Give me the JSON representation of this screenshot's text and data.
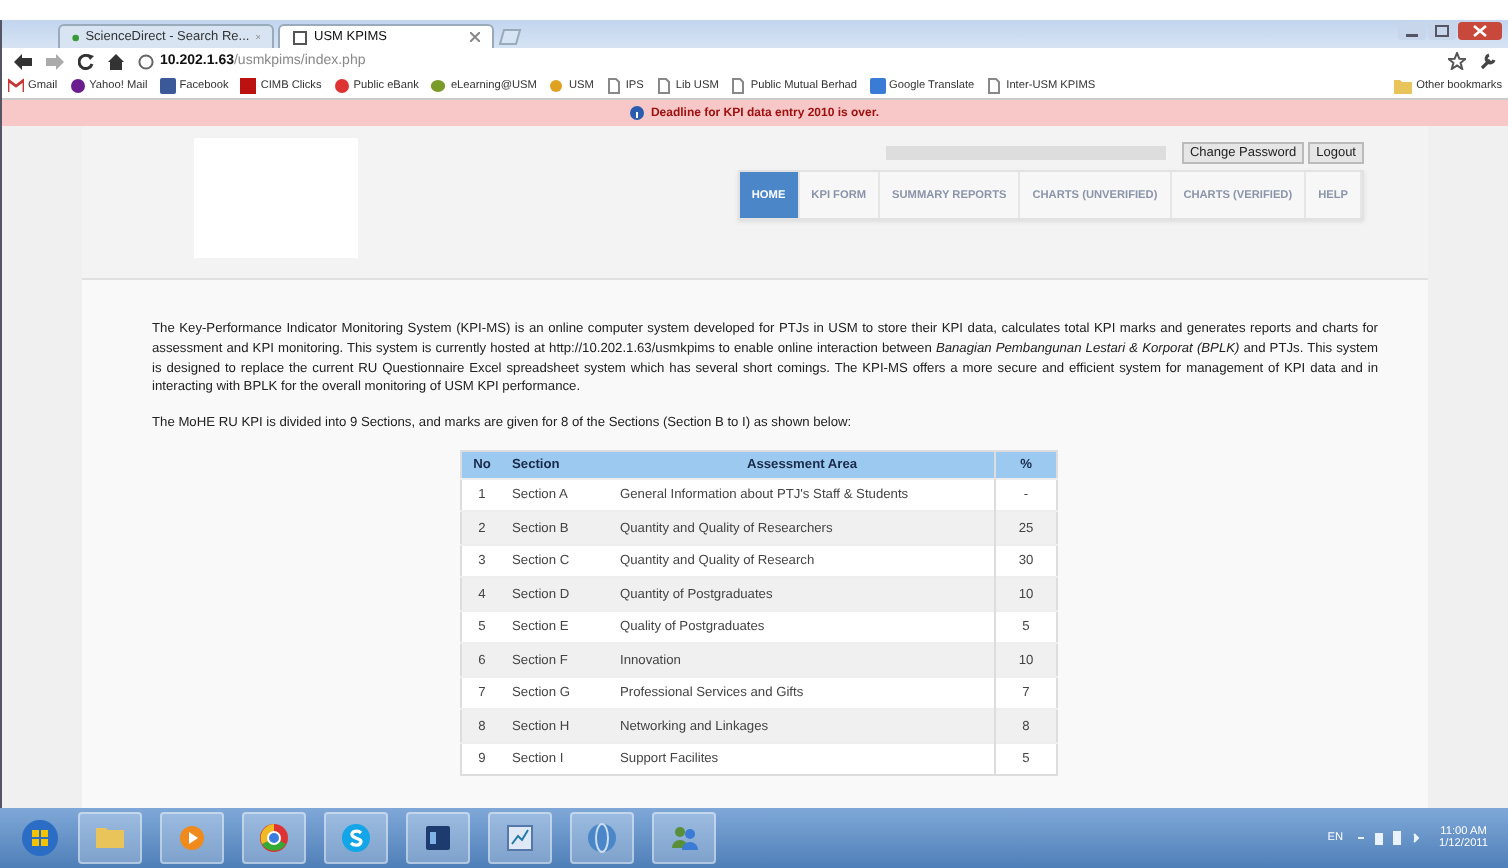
{
  "browser": {
    "tabs": [
      {
        "label": "ScienceDirect - Search Re...",
        "selected": false
      },
      {
        "label": "USM KPIMS",
        "selected": true
      }
    ],
    "address": {
      "host": "10.202.1.63",
      "path": "/usmkpims/index.php"
    },
    "bookmarks": [
      "Gmail",
      "Yahoo! Mail",
      "Facebook",
      "CIMB Clicks",
      "Public eBank",
      "eLearning@USM",
      "USM",
      "IPS",
      "Lib USM",
      "Public Mutual Berhad",
      "Google Translate",
      "Inter-USM KPIMS"
    ],
    "other_bookmarks": "Other bookmarks"
  },
  "notice": "Deadline for KPI data entry 2010 is over.",
  "account_buttons": [
    "Change Password",
    "Logout"
  ],
  "nav": [
    {
      "label": "HOME",
      "selected": true
    },
    {
      "label": "KPI FORM",
      "selected": false
    },
    {
      "label": "SUMMARY REPORTS",
      "selected": false
    },
    {
      "label": "CHARTS (UNVERIFIED)",
      "selected": false
    },
    {
      "label": "CHARTS (VERIFIED)",
      "selected": false
    },
    {
      "label": "HELP",
      "selected": false
    }
  ],
  "paragraphs": [
    "The Key-Performance Indicator Monitoring System (KPI-MS) is an online computer system developed for PTJs in USM to store their KPI data, calculates total KPI marks and generates reports and charts for assessment and KPI monitoring. This system is currently hosted at http://10.202.1.63/usmkpims to enable online interaction between *Banagian Pembangunan Lestari & Korporat (BPLK)* and PTJs. This system is designed to replace the current RU Questionnaire Excel spreadsheet system which has several short comings. The KPI-MS offers a more secure and efficient system for management of KPI data and in interacting with BPLK for the overall monitoring of USM KPI performance.",
    "The MoHE RU KPI is divided into 9 Sections, and marks are given for 8 of the Sections (Section B to I) as shown below:"
  ],
  "table": {
    "columns": [
      "No",
      "Section",
      "Assessment Area",
      "%"
    ],
    "rows": [
      [
        "1",
        "Section A",
        "General Information about PTJ's Staff & Students",
        "-"
      ],
      [
        "2",
        "Section B",
        "Quantity and Quality of Researchers",
        "25"
      ],
      [
        "3",
        "Section C",
        "Quantity and Quality of Research",
        "30"
      ],
      [
        "4",
        "Section D",
        "Quantity of Postgraduates",
        "10"
      ],
      [
        "5",
        "Section E",
        "Quality of Postgraduates",
        "5"
      ],
      [
        "6",
        "Section F",
        "Innovation",
        "10"
      ],
      [
        "7",
        "Section G",
        "Professional Services and Gifts",
        "7"
      ],
      [
        "8",
        "Section H",
        "Networking and Linkages",
        "8"
      ],
      [
        "9",
        "Section I",
        "Support Facilites",
        "5"
      ]
    ]
  },
  "taskbar": {
    "language": "EN",
    "time": "11:00 AM",
    "date": "1/12/2011"
  }
}
